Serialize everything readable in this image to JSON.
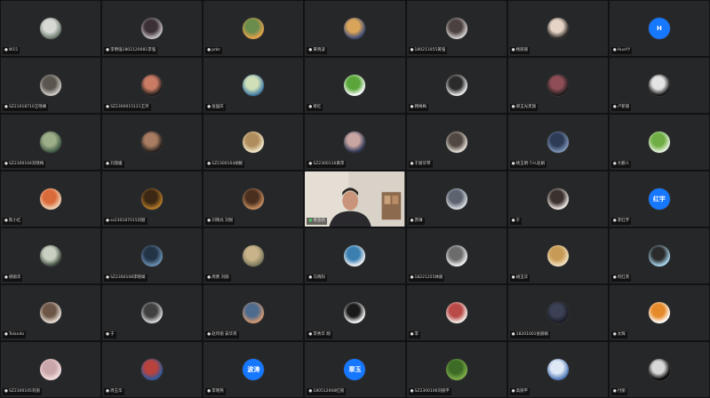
{
  "participants": [
    {
      "name": "W15",
      "avatar": {
        "type": "photo",
        "c1": "#6b7a6e",
        "c2": "#d7d9d4"
      }
    },
    {
      "name": "李明强1802120081李强",
      "avatar": {
        "type": "photo",
        "c1": "#c9c2c7",
        "c2": "#3b3035"
      }
    },
    {
      "name": "pdsr",
      "avatar": {
        "type": "photo",
        "c1": "#e8a34a",
        "c2": "#6a8c4c"
      }
    },
    {
      "name": "黄晓波",
      "avatar": {
        "type": "photo",
        "c1": "#3c4a7a",
        "c2": "#d9a55b"
      }
    },
    {
      "name": "180211055黄强",
      "avatar": {
        "type": "photo",
        "c1": "#d6d2cf",
        "c2": "#4b4140"
      }
    },
    {
      "name": "杨丽丽",
      "avatar": {
        "type": "photo",
        "c1": "#2a2524",
        "c2": "#e6d5c6"
      }
    },
    {
      "name": "HuaYY",
      "avatar": {
        "type": "initial",
        "text": "H",
        "color": "#1677ff"
      }
    },
    {
      "name": "SZ21018710王晓峰",
      "avatar": {
        "type": "photo",
        "c1": "#d1ccc6",
        "c2": "#5b5550"
      }
    },
    {
      "name": "SZ2300015121王玲",
      "avatar": {
        "type": "photo",
        "c1": "#1c1a1a",
        "c2": "#c97b64"
      }
    },
    {
      "name": "张国庆",
      "avatar": {
        "type": "photo",
        "c1": "#3f7aa6",
        "c2": "#cfe0b8"
      }
    },
    {
      "name": "蒋红",
      "avatar": {
        "type": "photo",
        "c1": "#ffffff",
        "c2": "#5aa63a"
      }
    },
    {
      "name": "韩梅梅",
      "avatar": {
        "type": "photo",
        "c1": "#f1f1f1",
        "c2": "#2b2b2b"
      }
    },
    {
      "name": "郑玉光黑旗",
      "avatar": {
        "type": "photo",
        "c1": "#1d1b1d",
        "c2": "#8f4e57"
      }
    },
    {
      "name": "卢新丽",
      "avatar": {
        "type": "photo",
        "c1": "#111111",
        "c2": "#e4e4e4"
      }
    },
    {
      "name": "SZ2300104刘晓梅",
      "avatar": {
        "type": "photo",
        "c1": "#3f5a44",
        "c2": "#9dae88"
      }
    },
    {
      "name": "刘淑媛",
      "avatar": {
        "type": "photo",
        "c1": "#231d1b",
        "c2": "#a87d62"
      }
    },
    {
      "name": "SZ2300104胡妮",
      "avatar": {
        "type": "photo",
        "c1": "#f1e8c9",
        "c2": "#b08d5c"
      }
    },
    {
      "name": "SZ2300116黄萍",
      "avatar": {
        "type": "photo",
        "c1": "#2c3556",
        "c2": "#c9a6a2"
      }
    },
    {
      "name": "于丽华琴",
      "avatar": {
        "type": "photo",
        "c1": "#e6e1d7",
        "c2": "#504741"
      }
    },
    {
      "name": "杨玉明-T.H.赵娟",
      "avatar": {
        "type": "photo",
        "c1": "#7f95b9",
        "c2": "#2d3b56"
      }
    },
    {
      "name": "大鹏人",
      "avatar": {
        "type": "photo",
        "c1": "#e9f2df",
        "c2": "#6fae44"
      }
    },
    {
      "name": "陈小红",
      "avatar": {
        "type": "photo",
        "c1": "#f0d3b4",
        "c2": "#d96a3a"
      }
    },
    {
      "name": "sz230187015刘丽",
      "avatar": {
        "type": "photo",
        "c1": "#b67a28",
        "c2": "#3b2714"
      }
    },
    {
      "name": "刘晓光 刘悦",
      "avatar": {
        "type": "photo",
        "c1": "#c78d5f",
        "c2": "#4a2f1f"
      }
    },
    {
      "name": "黄金刚",
      "avatar": {
        "type": "video"
      }
    },
    {
      "name": "苏琳",
      "avatar": {
        "type": "photo",
        "c1": "#d8dde3",
        "c2": "#5d6470"
      }
    },
    {
      "name": "于",
      "avatar": {
        "type": "photo",
        "c1": "#f0e9e4",
        "c2": "#3b3230"
      }
    },
    {
      "name": "李红宇",
      "avatar": {
        "type": "initial",
        "text": "红宇",
        "color": "#1677ff"
      }
    },
    {
      "name": "杨丽华",
      "avatar": {
        "type": "photo",
        "c1": "#3e4a3e",
        "c2": "#c9d0c2"
      }
    },
    {
      "name": "SZ2300108李晓娟",
      "avatar": {
        "type": "photo",
        "c1": "#6a8fb3",
        "c2": "#233447"
      }
    },
    {
      "name": "周勇 刘丽",
      "avatar": {
        "type": "photo",
        "c1": "#7c7a5c",
        "c2": "#c9b38a"
      }
    },
    {
      "name": "马晓阳",
      "avatar": {
        "type": "photo",
        "c1": "#f4f4f4",
        "c2": "#3a7fb0"
      }
    },
    {
      "name": "18221255林丽",
      "avatar": {
        "type": "photo",
        "c1": "#f2f2f2",
        "c2": "#6c6c6c"
      }
    },
    {
      "name": "胡玉华",
      "avatar": {
        "type": "photo",
        "c1": "#f2e2c0",
        "c2": "#c79a55"
      }
    },
    {
      "name": "何红英",
      "avatar": {
        "type": "photo",
        "c1": "#a9d8f2",
        "c2": "#2b2b2b"
      }
    },
    {
      "name": "Tolando",
      "avatar": {
        "type": "photo",
        "c1": "#e9e0d8",
        "c2": "#6d5646"
      }
    },
    {
      "name": "于",
      "avatar": {
        "type": "photo",
        "c1": "#d9d9d9",
        "c2": "#404040"
      }
    },
    {
      "name": "赵玲丽 安华英",
      "avatar": {
        "type": "photo",
        "c1": "#d79a70",
        "c2": "#4d6b8c"
      }
    },
    {
      "name": "李秀华 翔",
      "avatar": {
        "type": "photo",
        "c1": "#ffffff",
        "c2": "#1a1a1a"
      }
    },
    {
      "name": "李",
      "avatar": {
        "type": "photo",
        "c1": "#f4f0ea",
        "c2": "#b94a48"
      }
    },
    {
      "name": "18201001张丽娟",
      "avatar": {
        "type": "photo",
        "c1": "#1a1c24",
        "c2": "#3c4155"
      }
    },
    {
      "name": "文辉",
      "avatar": {
        "type": "photo",
        "c1": "#ffffff",
        "c2": "#e58a2a"
      }
    },
    {
      "name": "SZ2300105刘丽",
      "avatar": {
        "type": "photo",
        "c1": "#f5dfe0",
        "c2": "#c9a6aa"
      }
    },
    {
      "name": "周玉华",
      "avatar": {
        "type": "photo",
        "c1": "#2d5aa0",
        "c2": "#b8423c"
      }
    },
    {
      "name": "李晓燕",
      "avatar": {
        "type": "initial",
        "text": "波涛",
        "color": "#1677ff"
      }
    },
    {
      "name": "180512008红丽",
      "avatar": {
        "type": "initial",
        "text": "翠玉",
        "color": "#1677ff"
      }
    },
    {
      "name": "SZ2300106刘丽平",
      "avatar": {
        "type": "photo",
        "c1": "#7fb04a",
        "c2": "#3d6a25"
      }
    },
    {
      "name": "高丽平",
      "avatar": {
        "type": "photo",
        "c1": "#4e78b8",
        "c2": "#dfe8f5"
      }
    },
    {
      "name": "付丽",
      "avatar": {
        "type": "photo",
        "c1": "#000000",
        "c2": "#d8d8d8"
      }
    }
  ]
}
